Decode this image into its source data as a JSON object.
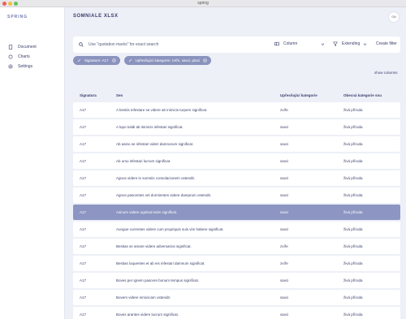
{
  "window": {
    "title": "spring"
  },
  "sidebar": {
    "brand": "SPRING",
    "items": [
      {
        "label": "Document",
        "icon": "document-icon"
      },
      {
        "label": "Charts",
        "icon": "circle-icon"
      },
      {
        "label": "Settings",
        "icon": "gear-icon"
      }
    ]
  },
  "main": {
    "title": "SOMNIALE XLSX",
    "avatar": "ON"
  },
  "toolbar": {
    "search_placeholder": "Use \"quotation marks\" for exact search",
    "columns_label": "Column",
    "filter_label": "Extending",
    "create_filter_label": "Create filter"
  },
  "chips": [
    {
      "label": "Signature: A17"
    },
    {
      "label": "Upřesňující kategorie: zvíře, savci, ptaci"
    }
  ],
  "show_columns": "show columns",
  "table": {
    "headers": [
      "Signatura",
      "Sen",
      "Upřesňující kategorie",
      "Obecná kategorie snu"
    ],
    "rows": [
      [
        "A17",
        "A bestiis infestare se videre ab inimicis turpem significat.",
        "zvíře",
        "živá příroda"
      ],
      [
        "A17",
        "A lupo totidi ab inimicis infestari significat.",
        "savci",
        "živá příroda"
      ],
      [
        "A17",
        "Ab asino se infestari videri damnorum significat.",
        "savci",
        "živá příroda"
      ],
      [
        "A17",
        "Ab urso infestari lucrum significat.",
        "savci",
        "živá příroda"
      ],
      [
        "A17",
        "Agnos videre in somniis consolacionem ostendit.",
        "savci",
        "živá příroda"
      ],
      [
        "A17",
        "Agnos pascentes vel dormientes videre damprum ostendit.",
        "savci",
        "živá příroda"
      ],
      [
        "A17",
        "Asinum videre ognitud esim significat.",
        "savci",
        "živá příroda"
      ],
      [
        "A17",
        "Aungue currentes videre cum propriquis suis vim habere significat.",
        "savci",
        "živá příroda"
      ],
      [
        "A17",
        "Bestias se amare videre adversarios significat.",
        "zvíře",
        "živá příroda"
      ],
      [
        "A17",
        "Bestias loquentes et ab eis infestari damnum significat.",
        "zvíře",
        "živá příroda"
      ],
      [
        "A17",
        "Boves per ignem pascere bonum tempus significat.",
        "savci",
        "živá příroda"
      ],
      [
        "A17",
        "Bovem videre nimicicam ostendit.",
        "savci",
        "živá příroda"
      ],
      [
        "A17",
        "Boves arantes videre lucrum significat.",
        "savci",
        "živá příroda"
      ]
    ],
    "selected_row": 6
  }
}
